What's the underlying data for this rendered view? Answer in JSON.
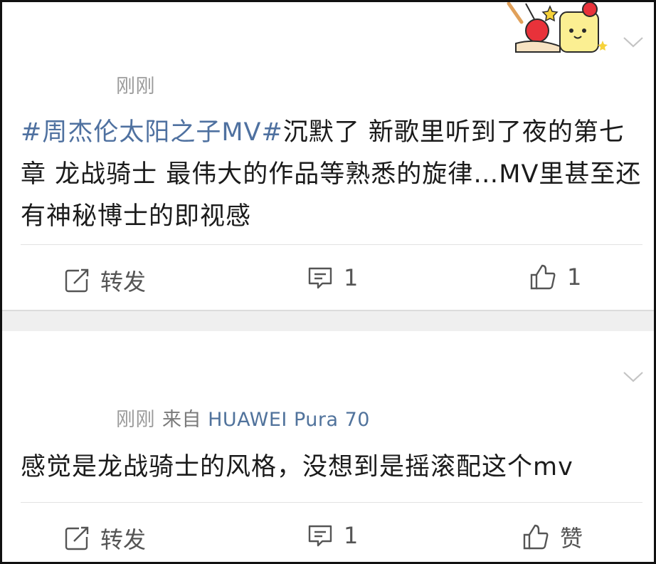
{
  "post1": {
    "time": "刚刚",
    "hashtag": "#周杰伦太阳之子MV#",
    "text": "沉默了 新歌里听到了夜的第七章 龙战骑士 最伟大的作品等熟悉的旋律…MV里甚至还有神秘博士的即视感",
    "actions": {
      "repost_label": "转发",
      "comment_count": "1",
      "like_count": "1"
    }
  },
  "post2": {
    "time": "刚刚",
    "source_prefix": "来自",
    "device": "HUAWEI Pura 70",
    "text": "感觉是龙战骑士的风格，没想到是摇滚配这个mv",
    "actions": {
      "repost_label": "转发",
      "comment_count": "1",
      "like_label": "赞"
    }
  },
  "icons": [
    "chevron-down-icon",
    "repost-icon",
    "comment-icon",
    "like-icon",
    "sticker-decoration"
  ],
  "colors": {
    "link": "#4f71a0",
    "meta": "#9b9b9b",
    "text": "#1b1b1b",
    "separator": "#efefef"
  }
}
